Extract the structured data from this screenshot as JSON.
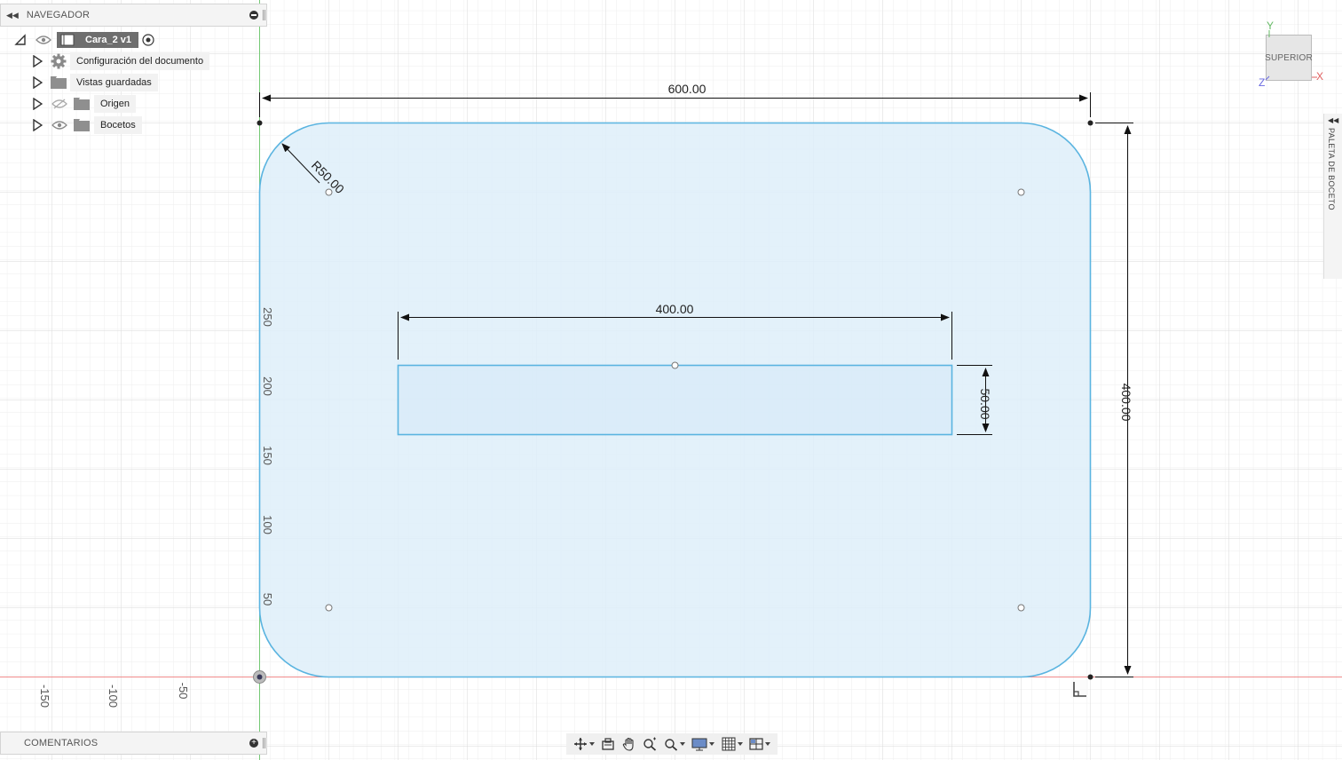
{
  "navigator": {
    "title": "NAVEGADOR",
    "document": "Cara_2 v1",
    "items": [
      {
        "label": "Configuración del documento",
        "icon": "gear-icon",
        "visible": null
      },
      {
        "label": "Vistas guardadas",
        "icon": "folder-icon",
        "visible": null
      },
      {
        "label": "Origen",
        "icon": "folder-icon",
        "visible": false
      },
      {
        "label": "Bocetos",
        "icon": "folder-icon",
        "visible": true
      }
    ]
  },
  "comments": {
    "title": "COMENTARIOS"
  },
  "palette": {
    "title": "PALETA DE BOCETO"
  },
  "viewcube": {
    "face": "SUPERIOR",
    "axes": {
      "x": "X",
      "y": "Y",
      "z": "Z"
    }
  },
  "sketch": {
    "outer_width": "600.00",
    "outer_height": "400.00",
    "corner_radius": "R50.00",
    "slot_width": "400.00",
    "slot_height": "50.00",
    "v_ruler": [
      "250",
      "200",
      "150",
      "100",
      "50"
    ],
    "h_ruler": [
      "-150",
      "-100",
      "-50"
    ]
  },
  "colors": {
    "profile_fill": "#ddeefa",
    "profile_stroke": "#5ab4e0",
    "grid_minor": "#ececec",
    "grid_major": "#d9d9d9",
    "x_axis": "#f08080",
    "y_axis": "#6cc86c"
  }
}
